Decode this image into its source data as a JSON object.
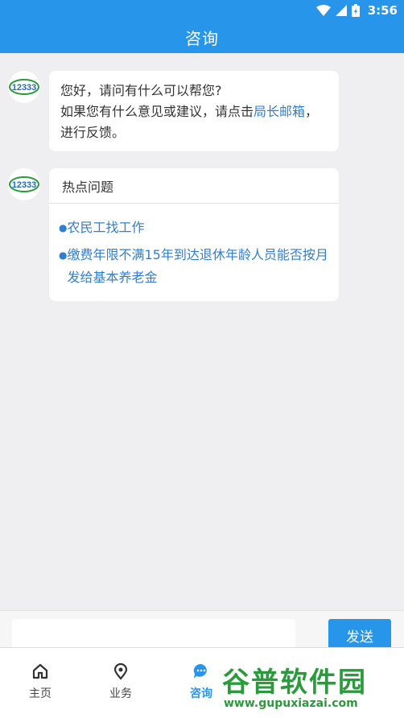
{
  "status_bar": {
    "time": "3:56"
  },
  "app_bar": {
    "title": "咨询"
  },
  "chat": {
    "welcome": {
      "line1": "您好，请问有什么可以帮您?",
      "line2_prefix": "如果您有什么意见或建议，请点击",
      "link": "局长邮箱",
      "line2_suffix": "，进行反馈。"
    },
    "hot": {
      "header": "热点问题",
      "questions": [
        "农民工找工作",
        "缴费年限不满15年到达退休年龄人员能否按月发给基本养老金"
      ]
    },
    "avatar_text": "12333"
  },
  "input": {
    "value": "",
    "placeholder": "",
    "send_label": "发送"
  },
  "bottom_nav": {
    "items": [
      {
        "label": "主页",
        "icon": "home-icon"
      },
      {
        "label": "业务",
        "icon": "location-pin-icon"
      },
      {
        "label": "咨询",
        "icon": "chat-bubble-icon",
        "active": true
      }
    ]
  },
  "watermark": {
    "title": "谷普软件园",
    "url": "www.gupuxiazai.com"
  },
  "colors": {
    "primary": "#2796ea",
    "link": "#2f7fd0",
    "background": "#efeff1",
    "watermark": "#2a9b3b"
  }
}
